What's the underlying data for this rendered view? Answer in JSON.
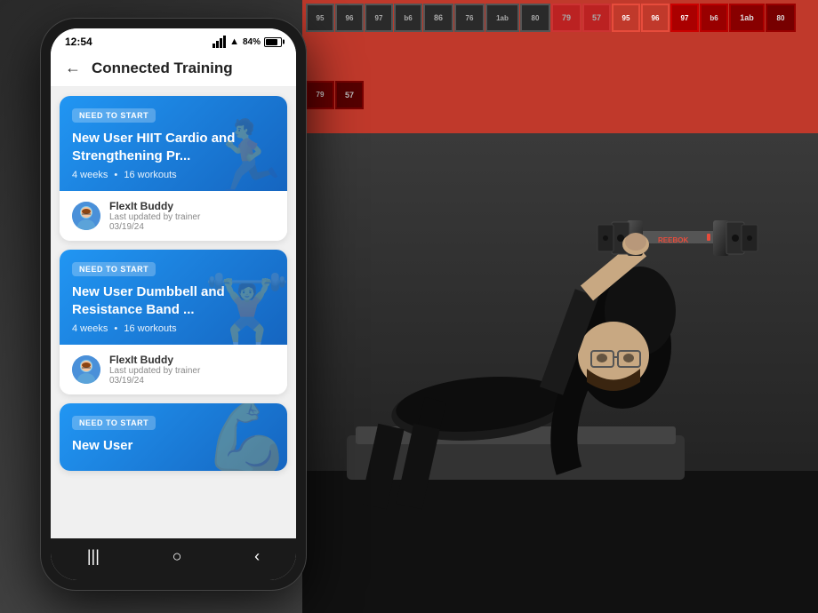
{
  "background": {
    "rackNumbers": [
      "95",
      "96",
      "97",
      "b6",
      "86",
      "76",
      "1ab",
      "80",
      "79",
      "57",
      "95",
      "96",
      "97"
    ]
  },
  "phone": {
    "statusBar": {
      "time": "12:54",
      "signal": "all",
      "batteryPercent": "84%"
    },
    "header": {
      "backLabel": "←",
      "title": "Connected Training"
    },
    "cards": [
      {
        "badge": "NEED TO START",
        "title": "New User HIIT Cardio and Strengthening Pr...",
        "weeks": "4 weeks",
        "workouts": "16 workouts",
        "trainerName": "FlexIt Buddy",
        "lastUpdated": "Last updated by trainer",
        "updateDate": "03/19/24",
        "icon": "🏃"
      },
      {
        "badge": "NEED TO START",
        "title": "New User Dumbbell and Resistance Band ...",
        "weeks": "4 weeks",
        "workouts": "16 workouts",
        "trainerName": "FlexIt Buddy",
        "lastUpdated": "Last updated by trainer",
        "updateDate": "03/19/24",
        "icon": "🏋"
      },
      {
        "badge": "NEED TO START",
        "title": "New User",
        "weeks": "",
        "workouts": "",
        "trainerName": "",
        "lastUpdated": "",
        "updateDate": "",
        "icon": "💪",
        "partial": true
      }
    ],
    "nav": {
      "items": [
        "|||",
        "○",
        "‹"
      ]
    }
  }
}
